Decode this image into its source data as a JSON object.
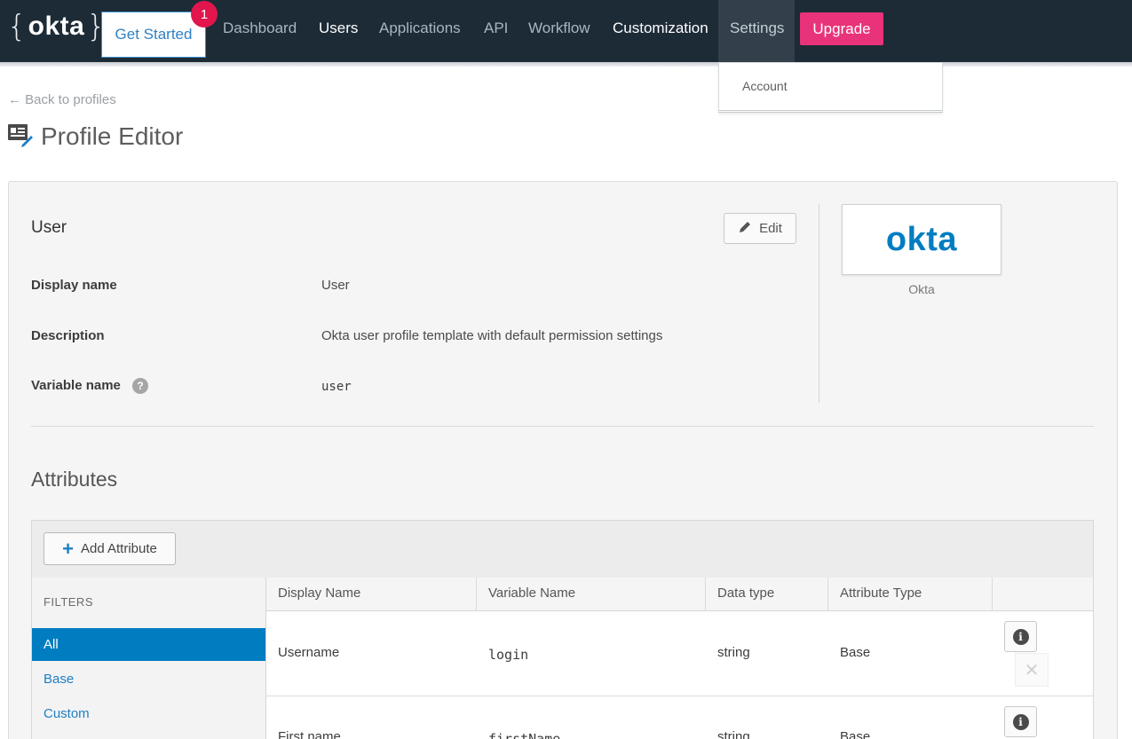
{
  "nav": {
    "brand": "okta",
    "get_started": "Get Started",
    "notification_count": "1",
    "items": [
      "Dashboard",
      "Users",
      "Applications",
      "API",
      "Workflow",
      "Customization",
      "Settings"
    ],
    "upgrade": "Upgrade",
    "settings_dropdown": [
      "Account"
    ]
  },
  "page": {
    "back_link": "← Back to profiles",
    "title": "Profile Editor"
  },
  "profile": {
    "section_title": "User",
    "edit_label": "Edit",
    "display_name_label": "Display name",
    "display_name": "User",
    "description_label": "Description",
    "description": "Okta user profile template with default permission settings",
    "variable_name_label": "Variable name",
    "variable_name": "user",
    "help_glyph": "?",
    "app_logo_text": "okta",
    "app_name": "Okta"
  },
  "attributes": {
    "title": "Attributes",
    "add_label": "Add Attribute",
    "filters_label": "FILTERS",
    "filters": [
      "All",
      "Base",
      "Custom"
    ],
    "active_filter": "All",
    "columns": [
      "Display Name",
      "Variable Name",
      "Data type",
      "Attribute Type"
    ],
    "rows": [
      {
        "display_name": "Username",
        "variable_name": "login",
        "data_type": "string",
        "attribute_type": "Base"
      },
      {
        "display_name": "First name",
        "variable_name": "firstName",
        "data_type": "string",
        "attribute_type": "Base"
      }
    ]
  },
  "colors": {
    "nav_bg": "#1d2b36",
    "accent_blue": "#007dc1",
    "upgrade_pink": "#e8337a",
    "badge_red": "#e0164d"
  },
  "icons": [
    "profile-editor-icon",
    "pencil-icon",
    "plus-icon",
    "info-icon",
    "close-icon",
    "help-icon"
  ]
}
